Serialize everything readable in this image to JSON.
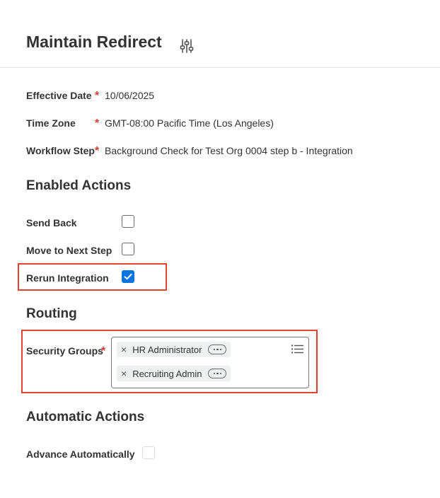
{
  "header": {
    "title": "Maintain Redirect",
    "settings_icon": "sliders-icon"
  },
  "fields": {
    "effective_date": {
      "label": "Effective Date",
      "required": "*",
      "value": "10/06/2025"
    },
    "time_zone": {
      "label": "Time Zone",
      "required": "*",
      "value": "GMT-08:00 Pacific Time (Los Angeles)"
    },
    "workflow_step": {
      "label": "Workflow Step",
      "required": "*",
      "value": "Background Check for Test Org 0004 step b - Integration"
    }
  },
  "enabled_actions": {
    "title": "Enabled Actions",
    "items": [
      {
        "label": "Send Back",
        "checked": false
      },
      {
        "label": "Move to Next Step",
        "checked": false
      },
      {
        "label": "Rerun Integration",
        "checked": true
      }
    ]
  },
  "routing": {
    "title": "Routing",
    "security_groups": {
      "label": "Security Groups",
      "required": "*",
      "selected": [
        "HR Administrator",
        "Recruiting Admin"
      ],
      "remove_glyph": "×",
      "list_icon": "list-icon"
    }
  },
  "automatic_actions": {
    "title": "Automatic Actions",
    "items": [
      {
        "label": "Advance Automatically",
        "checked": false,
        "disabled": true
      }
    ]
  },
  "colors": {
    "accent": "#0875e1",
    "required": "#de3c2f",
    "highlight": "#e0432f"
  }
}
